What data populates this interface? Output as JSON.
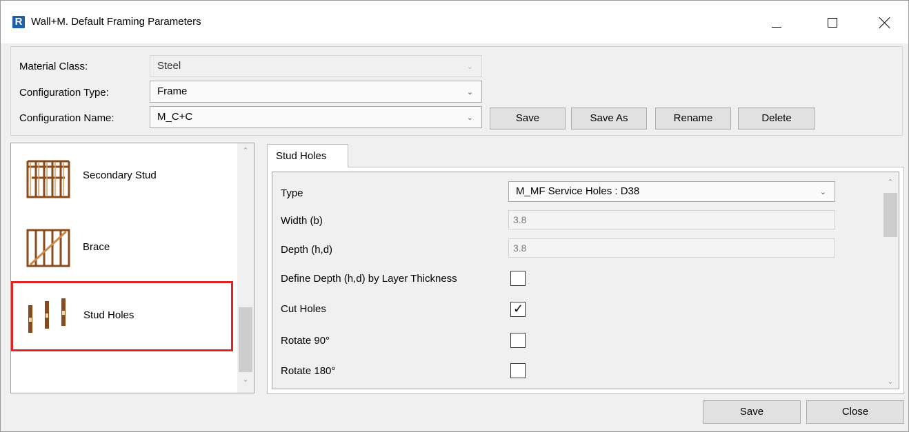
{
  "window": {
    "title": "Wall+M. Default Framing Parameters",
    "app_icon_letter": "R",
    "accent": "#1f5fa8"
  },
  "config": {
    "material_class_label": "Material Class:",
    "material_class_value": "Steel",
    "configuration_type_label": "Configuration Type:",
    "configuration_type_value": "Frame",
    "configuration_name_label": "Configuration Name:",
    "configuration_name_value": "M_C+C",
    "buttons": {
      "save": "Save",
      "save_as": "Save As",
      "rename": "Rename",
      "delete": "Delete"
    }
  },
  "list": {
    "items": [
      {
        "label": "Secondary Stud",
        "icon": "secondary-stud-frame-icon"
      },
      {
        "label": "Brace",
        "icon": "brace-frame-icon"
      },
      {
        "label": "Stud Holes",
        "icon": "stud-holes-icon",
        "selected": true
      }
    ],
    "highlight_color": "#e02424"
  },
  "tab": {
    "label": "Stud Holes"
  },
  "properties": {
    "type_label": "Type",
    "type_value": "M_MF Service Holes : D38",
    "width_label": "Width (b)",
    "width_value": "3.8",
    "depth_label": "Depth (h,d)",
    "depth_value": "3.8",
    "define_depth_label": "Define Depth (h,d) by Layer Thickness",
    "define_depth_checked": false,
    "cut_holes_label": "Cut Holes",
    "cut_holes_checked": true,
    "cut_holes_mark": "✓",
    "rotate90_label": "Rotate 90°",
    "rotate90_checked": false,
    "rotate180_label": "Rotate 180°",
    "rotate180_checked": false
  },
  "footer": {
    "save": "Save",
    "close": "Close"
  }
}
